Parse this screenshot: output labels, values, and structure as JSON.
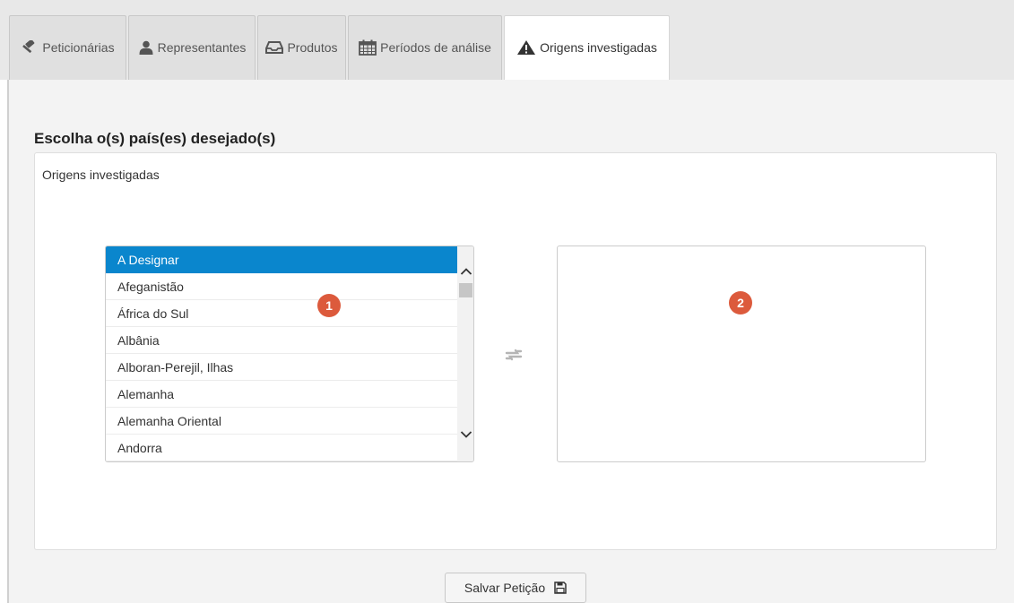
{
  "tabs": [
    {
      "label": "Peticionárias",
      "icon": "gavel-icon",
      "active": false
    },
    {
      "label": "Representantes",
      "icon": "user-icon",
      "active": false
    },
    {
      "label": "Produtos",
      "icon": "inbox-icon",
      "active": false
    },
    {
      "label": "Períodos de análise",
      "icon": "calendar-icon",
      "active": false
    },
    {
      "label": "Origens investigadas",
      "icon": "warning-icon",
      "active": true
    }
  ],
  "section": {
    "title": "Escolha o(s) país(es) desejado(s)",
    "label": "Origens investigadas"
  },
  "source_list": {
    "badge": "1",
    "selected_index": 0,
    "items": [
      "A Designar",
      "Afeganistão",
      "África do Sul",
      "Albânia",
      "Alboran-Perejil, Ilhas",
      "Alemanha",
      "Alemanha Oriental",
      "Andorra"
    ]
  },
  "target_list": {
    "badge": "2",
    "items": []
  },
  "transfer": {
    "icon": "exchange-icon"
  },
  "save_button": {
    "label": "Salvar Petição",
    "icon": "floppy-disk-icon"
  },
  "colors": {
    "selected": "#0a86cd",
    "badge": "#dc5a3c",
    "tab_inactive": "#e0e0e0",
    "content_bg": "#f3f3f3"
  }
}
